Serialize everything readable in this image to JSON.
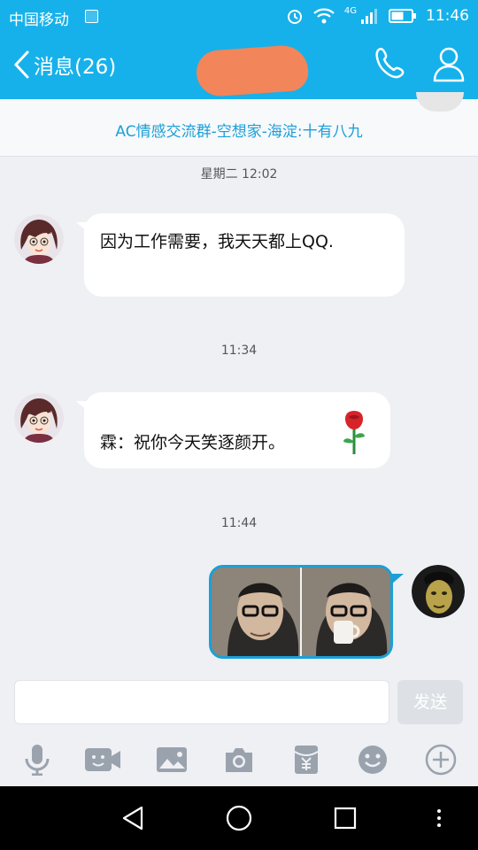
{
  "status_bar": {
    "carrier": "中国移动",
    "network": "4G",
    "time": "11:46"
  },
  "header": {
    "back_label": "消息(26)"
  },
  "group": {
    "name": "AC情感交流群-空想家-海淀:十有八九"
  },
  "messages": [
    {
      "type": "timestamp",
      "text": "星期二 12:02"
    },
    {
      "type": "incoming",
      "text": "因为工作需要，我天天都上QQ."
    },
    {
      "type": "timestamp",
      "text": "11:34"
    },
    {
      "type": "incoming",
      "text": "霖：祝你今天笑逐颜开。",
      "emoji": "rose-icon"
    },
    {
      "type": "timestamp",
      "text": "11:44"
    },
    {
      "type": "outgoing-image",
      "content": "two-panel photo"
    }
  ],
  "composer": {
    "input_value": "",
    "send_label": "发送"
  },
  "toolbar": [
    "microphone-icon",
    "video-icon",
    "image-icon",
    "camera-icon",
    "red-packet-icon",
    "emoji-icon",
    "plus-icon"
  ],
  "nav": [
    "back-icon",
    "home-icon",
    "recents-icon",
    "menu-icon"
  ],
  "colors": {
    "accent": "#16b1ea",
    "link": "#1aa0d8",
    "background": "#eef0f4"
  }
}
